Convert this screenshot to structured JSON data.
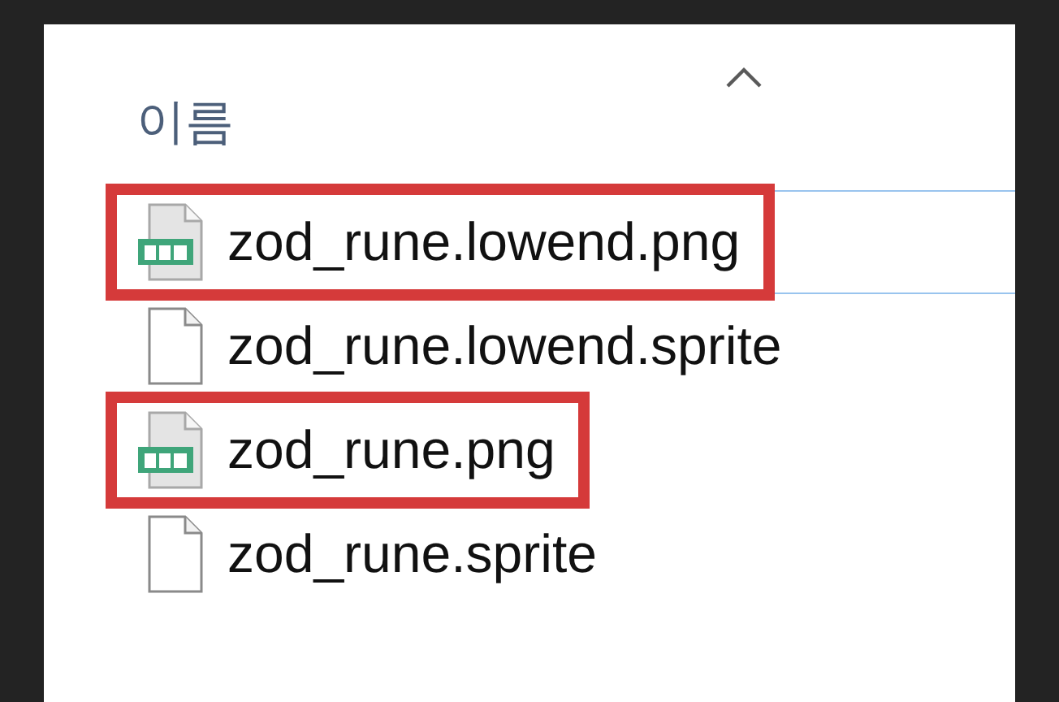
{
  "column_header": {
    "label": "이름",
    "sorted_ascending": true
  },
  "files": [
    {
      "name": "zod_rune.lowend.png",
      "kind": "png",
      "focused": true,
      "highlighted": true
    },
    {
      "name": "zod_rune.lowend.sprite",
      "kind": "file",
      "focused": false,
      "highlighted": false
    },
    {
      "name": "zod_rune.png",
      "kind": "png",
      "focused": false,
      "highlighted": true
    },
    {
      "name": "zod_rune.sprite",
      "kind": "file",
      "focused": false,
      "highlighted": false
    }
  ]
}
